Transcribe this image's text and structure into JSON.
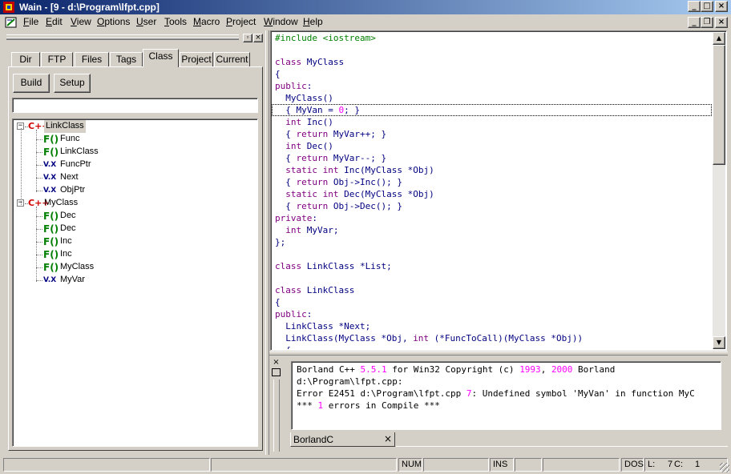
{
  "window": {
    "title": "Wain - [9 - d:\\Program\\lfpt.cpp]",
    "caption_buttons": [
      "_",
      "□",
      "×"
    ],
    "doc_buttons": [
      "_",
      "❐",
      "×"
    ]
  },
  "menu": [
    {
      "label": "File",
      "u": "F",
      "rest": "ile"
    },
    {
      "label": "Edit",
      "u": "E",
      "rest": "dit"
    },
    {
      "label": "View",
      "u": "V",
      "rest": "iew"
    },
    {
      "label": "Options",
      "u": "O",
      "rest": "ptions"
    },
    {
      "label": "User",
      "u": "U",
      "rest": "ser"
    },
    {
      "label": "Tools",
      "u": "T",
      "rest": "ools"
    },
    {
      "label": "Macro",
      "u": "M",
      "rest": "acro"
    },
    {
      "label": "Project",
      "u": "P",
      "rest": "roject"
    },
    {
      "label": "Window",
      "u": "W",
      "rest": "indow"
    },
    {
      "label": "Help",
      "u": "H",
      "rest": "elp"
    }
  ],
  "left_pane": {
    "tabs": [
      "Dir",
      "FTP",
      "Files",
      "Tags",
      "Class",
      "Project",
      "Current"
    ],
    "active_tab": "Class",
    "buttons": {
      "build": "Build",
      "setup": "Setup"
    },
    "filter_value": "",
    "tree": [
      {
        "label": "LinkClass",
        "icon": "C++",
        "kind": "class",
        "selected": true
      },
      {
        "label": "Func",
        "icon": "F()",
        "kind": "function"
      },
      {
        "label": "LinkClass",
        "icon": "F()",
        "kind": "function"
      },
      {
        "label": "FuncPtr",
        "icon": "V.X",
        "kind": "variable"
      },
      {
        "label": "Next",
        "icon": "V.X",
        "kind": "variable"
      },
      {
        "label": "ObjPtr",
        "icon": "V.X",
        "kind": "variable"
      },
      {
        "label": "MyClass",
        "icon": "C++",
        "kind": "class"
      },
      {
        "label": "Dec",
        "icon": "F()",
        "kind": "function"
      },
      {
        "label": "Dec",
        "icon": "F()",
        "kind": "function"
      },
      {
        "label": "Inc",
        "icon": "F()",
        "kind": "function"
      },
      {
        "label": "Inc",
        "icon": "F()",
        "kind": "function"
      },
      {
        "label": "MyClass",
        "icon": "F()",
        "kind": "function"
      },
      {
        "label": "MyVar",
        "icon": "V.X",
        "kind": "variable"
      }
    ],
    "expander_symbol": "−"
  },
  "editor": {
    "lines": [
      [
        [
          "pp",
          "#include <iostream>"
        ]
      ],
      [],
      [
        [
          "kw",
          "class"
        ],
        [
          "",
          " MyClass"
        ]
      ],
      [
        [
          "",
          "{"
        ]
      ],
      [
        [
          "kw",
          "public"
        ],
        [
          "",
          ":"
        ]
      ],
      [
        [
          "",
          "  MyClass()"
        ]
      ],
      [
        [
          "",
          "  { MyVan = "
        ],
        [
          "num",
          "0"
        ],
        [
          "",
          "; }"
        ]
      ],
      [
        [
          "",
          "  "
        ],
        [
          "kw",
          "int"
        ],
        [
          "",
          " Inc()"
        ]
      ],
      [
        [
          "",
          "  { "
        ],
        [
          "kw",
          "return"
        ],
        [
          "",
          " MyVar++; }"
        ]
      ],
      [
        [
          "",
          "  "
        ],
        [
          "kw",
          "int"
        ],
        [
          "",
          " Dec()"
        ]
      ],
      [
        [
          "",
          "  { "
        ],
        [
          "kw",
          "return"
        ],
        [
          "",
          " MyVar--; }"
        ]
      ],
      [
        [
          "",
          "  "
        ],
        [
          "kw",
          "static"
        ],
        [
          "",
          " "
        ],
        [
          "kw",
          "int"
        ],
        [
          "",
          " Inc(MyClass *Obj)"
        ]
      ],
      [
        [
          "",
          "  { "
        ],
        [
          "kw",
          "return"
        ],
        [
          "",
          " Obj->Inc(); }"
        ]
      ],
      [
        [
          "",
          "  "
        ],
        [
          "kw",
          "static"
        ],
        [
          "",
          " "
        ],
        [
          "kw",
          "int"
        ],
        [
          "",
          " Dec(MyClass *Obj)"
        ]
      ],
      [
        [
          "",
          "  { "
        ],
        [
          "kw",
          "return"
        ],
        [
          "",
          " Obj->Dec(); }"
        ]
      ],
      [
        [
          "kw",
          "private"
        ],
        [
          "",
          ":"
        ]
      ],
      [
        [
          "",
          "  "
        ],
        [
          "kw",
          "int"
        ],
        [
          "",
          " MyVar;"
        ]
      ],
      [
        [
          "",
          "};"
        ]
      ],
      [],
      [
        [
          "kw",
          "class"
        ],
        [
          "",
          " LinkClass *List;"
        ]
      ],
      [],
      [
        [
          "kw",
          "class"
        ],
        [
          "",
          " LinkClass"
        ]
      ],
      [
        [
          "",
          "{"
        ]
      ],
      [
        [
          "kw",
          "public"
        ],
        [
          "",
          ":"
        ]
      ],
      [
        [
          "",
          "  LinkClass *Next;"
        ]
      ],
      [
        [
          "",
          "  LinkClass(MyClass *Obj, "
        ],
        [
          "kw",
          "int"
        ],
        [
          "",
          " (*FuncToCall)(MyClass *Obj))"
        ]
      ],
      [
        [
          "",
          "  {"
        ]
      ]
    ],
    "cursor_line": 7,
    "scroll_up": "▲",
    "scroll_down": "▼"
  },
  "output": {
    "lines": [
      [
        [
          "",
          "Borland C++ "
        ],
        [
          "num",
          "5.5.1"
        ],
        [
          "",
          " for Win32 Copyright (c) "
        ],
        [
          "num",
          "1993"
        ],
        [
          "",
          ", "
        ],
        [
          "num",
          "2000"
        ],
        [
          "",
          " Borland"
        ]
      ],
      [
        [
          "",
          "d:\\Program\\lfpt.cpp:"
        ]
      ],
      [
        [
          "",
          "Error E2451 d:\\Program\\lfpt.cpp "
        ],
        [
          "num",
          "7"
        ],
        [
          "",
          ": Undefined symbol 'MyVan' in function MyC"
        ]
      ],
      [
        [
          "",
          "*** "
        ],
        [
          "num",
          "1"
        ],
        [
          "",
          " errors in Compile ***"
        ]
      ]
    ],
    "tab_label": "BorlandC",
    "tab_close": "×",
    "side_close": "×"
  },
  "status": {
    "num": "NUM",
    "ins": "INS",
    "eol": "DOS",
    "line_label": "L:",
    "line": "7",
    "col_label": "C:",
    "col": "1"
  },
  "colors": {
    "keyword": "#800080",
    "identifier": "#000080",
    "preprocessor": "#008000",
    "number": "#ff00ff",
    "title_gradient_start": "#0a246a",
    "title_gradient_end": "#a6caf0"
  }
}
